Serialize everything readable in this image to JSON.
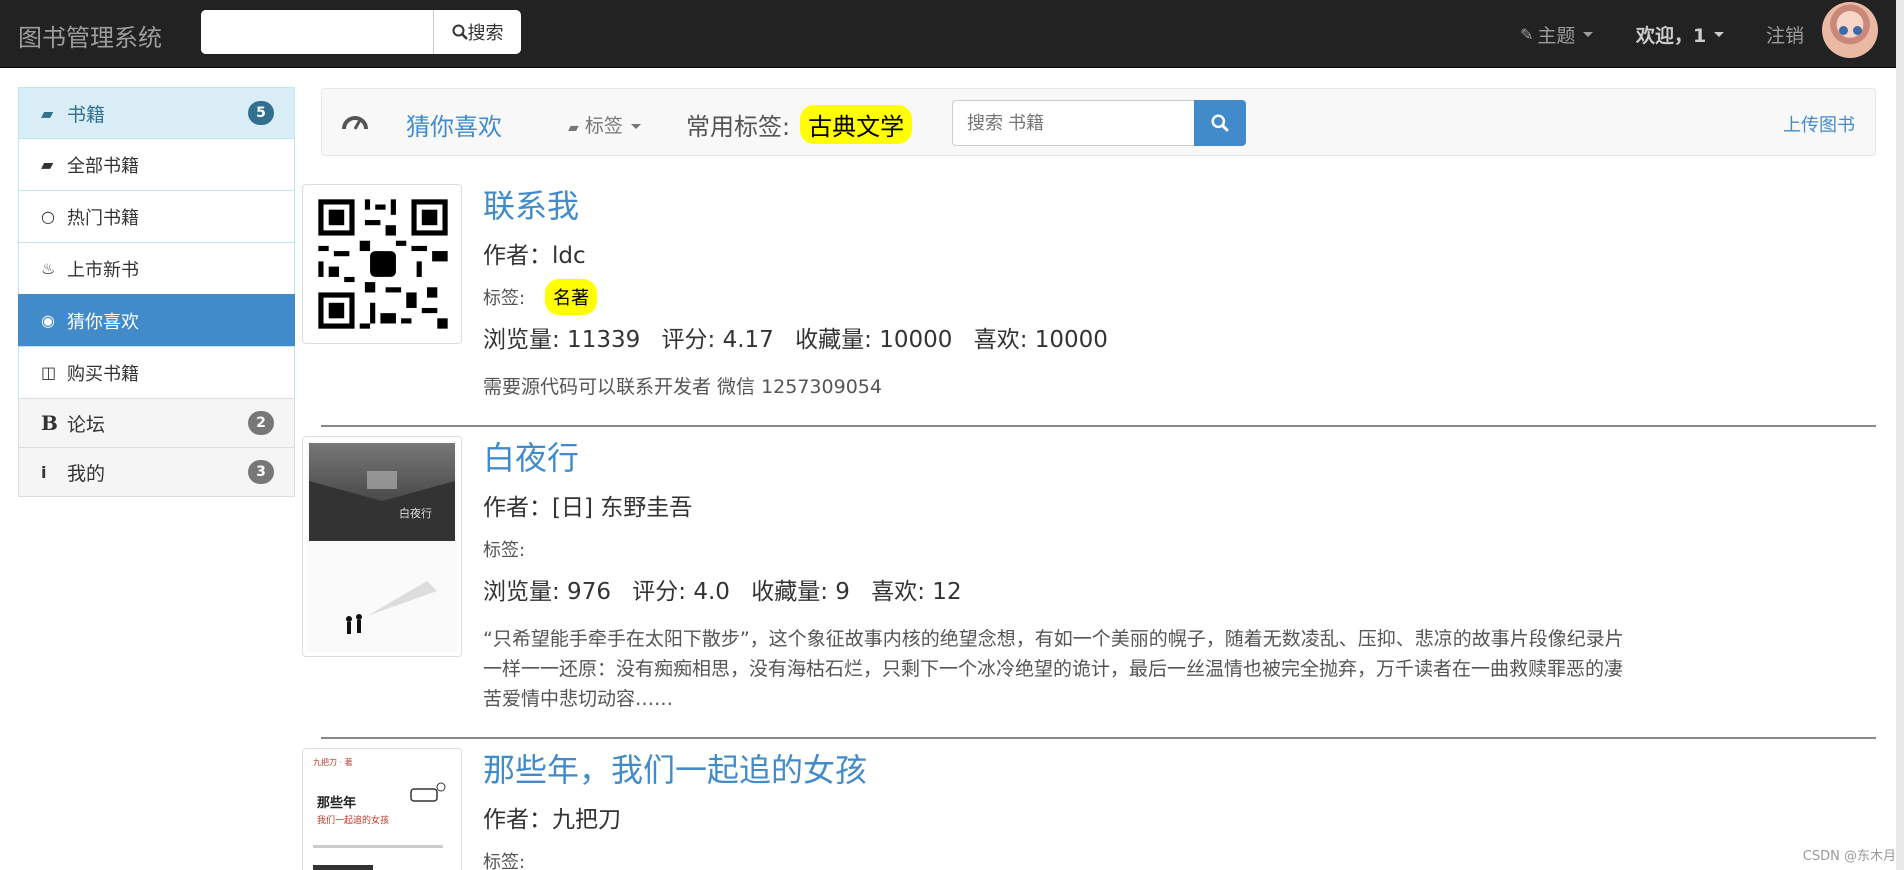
{
  "navbar": {
    "brand": "图书管理系统",
    "search_button": "搜索",
    "theme_label": "主题",
    "welcome_label": "欢迎，1",
    "logout_label": "注销"
  },
  "sidebar": {
    "books": {
      "label": "书籍",
      "badge": "5"
    },
    "items": [
      {
        "label": "全部书籍"
      },
      {
        "label": "热门书籍"
      },
      {
        "label": "上市新书"
      },
      {
        "label": "猜你喜欢"
      },
      {
        "label": "购买书籍"
      }
    ],
    "forum": {
      "label": "论坛",
      "badge": "2"
    },
    "mine": {
      "label": "我的",
      "badge": "3"
    }
  },
  "subnav": {
    "title": "猜你喜欢",
    "tags_label": "标签",
    "common_tags_label": "常用标签:",
    "common_tag": "古典文学",
    "search_placeholder": "搜索 书籍",
    "upload_label": "上传图书"
  },
  "books": [
    {
      "title": "联系我",
      "author": "作者：ldc",
      "tags_label": "标签:",
      "tag": "名著",
      "views": "浏览量: 11339",
      "rating": "评分: 4.17",
      "favorites": "收藏量: 10000",
      "likes": "喜欢: 10000",
      "desc": "需要源代码可以联系开发者 微信 1257309054"
    },
    {
      "title": "白夜行",
      "author": "作者：[日] 东野圭吾",
      "tags_label": "标签:",
      "tag": "",
      "views": "浏览量: 976",
      "rating": "评分: 4.0",
      "favorites": "收藏量: 9",
      "likes": "喜欢: 12",
      "desc": "“只希望能手牵手在太阳下散步”，这个象征故事内核的绝望念想，有如一个美丽的幌子，随着无数凌乱、压抑、悲凉的故事片段像纪录片一样一一还原：没有痴痴相思，没有海枯石烂，只剩下一个冰冷绝望的诡计，最后一丝温情也被完全抛弃，万千读者在一曲救赎罪恶的凄苦爱情中悲切动容……",
      "cover_title": "白夜行"
    },
    {
      "title": "那些年，我们一起追的女孩",
      "author": "作者：九把刀",
      "tags_label": "标签:",
      "cover_author": "九把刀 · 著",
      "cover_title": "那些年",
      "cover_subtitle": "我们一起追的女孩"
    }
  ],
  "watermark": "CSDN @东木月",
  "colors": {
    "primary": "#428bca",
    "highlight": "#ffff00",
    "navbar": "#222222"
  }
}
